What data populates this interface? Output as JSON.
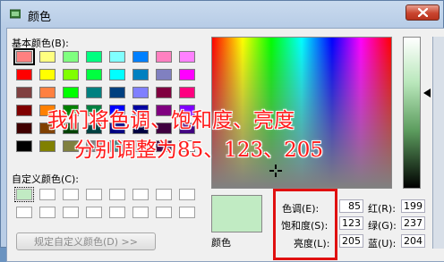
{
  "window": {
    "title": "颜色"
  },
  "basic_colors": {
    "label": "基本颜色(B):",
    "swatches": [
      "#ff8080",
      "#ffff80",
      "#80ff80",
      "#00ff80",
      "#80ffff",
      "#0080ff",
      "#ff80c0",
      "#ff80ff",
      "#ff0000",
      "#ffff00",
      "#80ff00",
      "#00ff40",
      "#00ffff",
      "#0080c0",
      "#8080c0",
      "#ff00ff",
      "#804040",
      "#ff8040",
      "#00ff00",
      "#008080",
      "#004080",
      "#8080ff",
      "#800040",
      "#ff0080",
      "#800000",
      "#ff8000",
      "#008000",
      "#008040",
      "#0000ff",
      "#0000a0",
      "#800080",
      "#8000ff",
      "#400000",
      "#804000",
      "#004000",
      "#004040",
      "#000080",
      "#000040",
      "#400040",
      "#400080",
      "#000000",
      "#808000",
      "#808040",
      "#808080",
      "#408080",
      "#c0c0c0",
      "#400040",
      "#ffffff"
    ]
  },
  "custom_colors": {
    "label": "自定义颜色(C):",
    "swatches": [
      "#c1ebc3",
      "#ffffff",
      "#ffffff",
      "#ffffff",
      "#ffffff",
      "#ffffff",
      "#ffffff",
      "#ffffff",
      "#ffffff",
      "#ffffff",
      "#ffffff",
      "#ffffff",
      "#ffffff",
      "#ffffff",
      "#ffffff",
      "#ffffff"
    ]
  },
  "define_button": {
    "label": "规定自定义颜色(D) >>"
  },
  "preview": {
    "label": "颜色"
  },
  "fields": {
    "hue": {
      "label": "色调(E):",
      "value": "85"
    },
    "sat": {
      "label": "饱和度(S):",
      "value": "123"
    },
    "lum": {
      "label": "亮度(L):",
      "value": "205"
    },
    "red": {
      "label": "红(R):",
      "value": "199"
    },
    "green": {
      "label": "绿(G):",
      "value": "237"
    },
    "blue": {
      "label": "蓝(U):",
      "value": "204"
    }
  },
  "annotation": {
    "line1": "我们将色调、饱和度、亮度",
    "line2": "分别调整为85、123、205",
    "color": "#ff1a1a"
  }
}
